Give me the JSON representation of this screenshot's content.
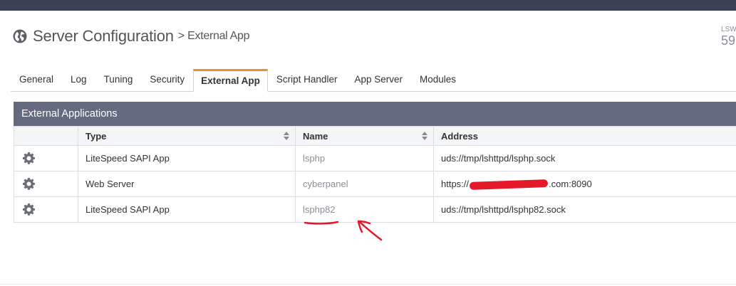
{
  "header": {
    "title": "Server Configuration",
    "separator": ">",
    "subtitle": "External App",
    "stat_label": "LSW",
    "stat_value": "59"
  },
  "tabs": [
    {
      "label": "General",
      "active": false
    },
    {
      "label": "Log",
      "active": false
    },
    {
      "label": "Tuning",
      "active": false
    },
    {
      "label": "Security",
      "active": false
    },
    {
      "label": "External App",
      "active": true
    },
    {
      "label": "Script Handler",
      "active": false
    },
    {
      "label": "App Server",
      "active": false
    },
    {
      "label": "Modules",
      "active": false
    }
  ],
  "panel": {
    "title": "External Applications",
    "columns": {
      "type": "Type",
      "name": "Name",
      "address": "Address"
    },
    "rows": [
      {
        "type": "LiteSpeed SAPI App",
        "name": "lsphp",
        "address": "uds://tmp/lshttpd/lsphp.sock"
      },
      {
        "type": "Web Server",
        "name": "cyberpanel",
        "address_prefix": "https://",
        "address_suffix": ".com:8090"
      },
      {
        "type": "LiteSpeed SAPI App",
        "name": "lsphp82",
        "address": "uds://tmp/lshttpd/lsphp82.sock"
      }
    ]
  },
  "colors": {
    "topbar": "#3b4154",
    "panel_header": "#646a80",
    "active_tab_accent": "#e8912d",
    "annotation": "#e5192a"
  },
  "icons": {
    "title": "globe-icon",
    "row_action": "gear-icon",
    "sort": "sort-icon"
  }
}
